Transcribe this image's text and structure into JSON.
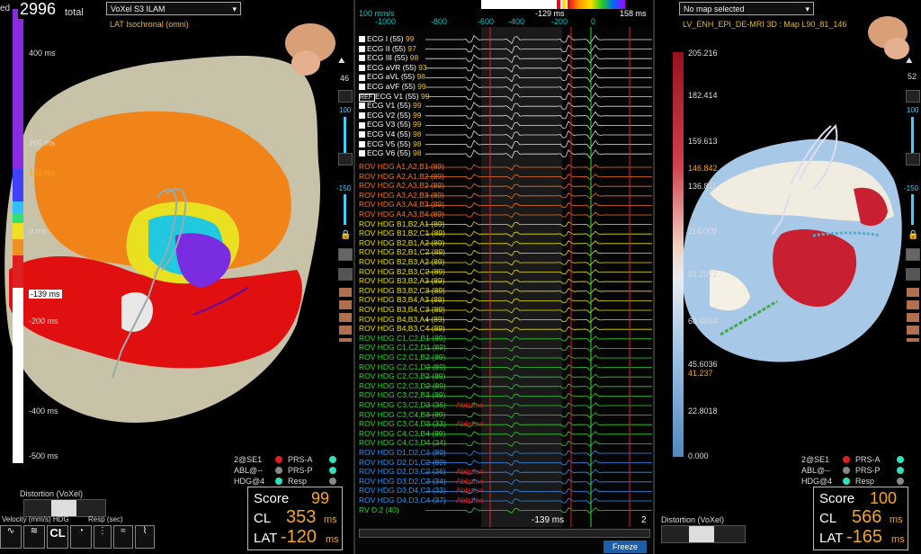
{
  "left": {
    "header_points": "2996",
    "header_total": "total",
    "header_prefix": "ed",
    "map_select": "VoXel S3 ILAM",
    "map_subtitle": "LAT Isochronal (omni)",
    "scale_labels": [
      "400 ms",
      "200 ms",
      "131 ms",
      "0 ms",
      "-139 ms",
      "-200 ms",
      "-400 ms",
      "-500 ms"
    ],
    "score_label": "Score",
    "score_value": "99",
    "cl_label": "CL",
    "cl_value": "353",
    "cl_unit": "ms",
    "lat_label": "LAT",
    "lat_value": "-120",
    "lat_unit": "ms",
    "legend": [
      {
        "a": "2@SE1",
        "b": "PRS-A"
      },
      {
        "a": "ABL@--",
        "b": "PRS-P"
      },
      {
        "a": "HDG@4",
        "b": "Resp"
      }
    ],
    "distortion_label": "Distortion (VoXel)",
    "velocity_label": "Velocity (mm/s) HDG",
    "resp_label": "Resp (sec)",
    "cl_button": "CL",
    "side_value_top": "46",
    "side_value_100": "100",
    "side_value_150": "-150"
  },
  "center": {
    "speed": "100 mm/s",
    "ticks": [
      "-1000",
      "-800",
      "-600",
      "-400",
      "-200",
      "0"
    ],
    "top_readout_left": "-129 ms",
    "top_readout_right": "158 ms",
    "bottom_readout": "-139 ms",
    "bottom_readout_right": "2",
    "freeze": "Freeze",
    "ecg_channels": [
      {
        "name": "ECG I",
        "code": "(55)",
        "val": "99"
      },
      {
        "name": "ECG II",
        "code": "(55)",
        "val": "97"
      },
      {
        "name": "ECG III",
        "code": "(55)",
        "val": "98"
      },
      {
        "name": "ECG aVR",
        "code": "(55)",
        "val": "93"
      },
      {
        "name": "ECG aVL",
        "code": "(55)",
        "val": "98"
      },
      {
        "name": "ECG aVF",
        "code": "(55)",
        "val": "99"
      },
      {
        "name": "ECG V1",
        "code": "(55)",
        "val": "99",
        "ref": "REF"
      },
      {
        "name": "ECG V1",
        "code": "(55)",
        "val": "99"
      },
      {
        "name": "ECG V2",
        "code": "(55)",
        "val": "99"
      },
      {
        "name": "ECG V3",
        "code": "(55)",
        "val": "99"
      },
      {
        "name": "ECG V4",
        "code": "(55)",
        "val": "98"
      },
      {
        "name": "ECG V5",
        "code": "(55)",
        "val": "98"
      },
      {
        "name": "ECG V6",
        "code": "(55)",
        "val": "98"
      }
    ],
    "hdg_channels": [
      {
        "label": "ROV HDG  A1,A2,B1 (89)",
        "color": "#f07020"
      },
      {
        "label": "ROV HDG  A2,A1,B2 (89)",
        "color": "#f07020"
      },
      {
        "label": "ROV HDG  A2,A3,B2 (89)",
        "color": "#f07020"
      },
      {
        "label": "ROV HDG  A3,A2,B3 (89)",
        "color": "#f07020"
      },
      {
        "label": "ROV HDG  A3,A4,B3 (89)",
        "color": "#f07020"
      },
      {
        "label": "ROV HDG  A4,A3,B4 (89)",
        "color": "#f07020"
      },
      {
        "label": "ROV HDG  B1,B2,A1 (89)",
        "color": "#e8e000"
      },
      {
        "label": "ROV HDG  B1,B2,C1 (89)",
        "color": "#e8e000"
      },
      {
        "label": "ROV HDG  B2,B1,A2 (89)",
        "color": "#e8e000"
      },
      {
        "label": "ROV HDG  B2,B1,C2 (89)",
        "color": "#e8e000"
      },
      {
        "label": "ROV HDG  B2,B3,A2 (89)",
        "color": "#e8e000"
      },
      {
        "label": "ROV HDG  B2,B3,C2 (89)",
        "color": "#e8e000"
      },
      {
        "label": "ROV HDG  B3,B2,A3 (89)",
        "color": "#e8e000"
      },
      {
        "label": "ROV HDG  B3,B2,C3 (89)",
        "color": "#e8e000"
      },
      {
        "label": "ROV HDG  B3,B4,A3 (89)",
        "color": "#e8e000"
      },
      {
        "label": "ROV HDG  B3,B4,C3 (89)",
        "color": "#e8e000"
      },
      {
        "label": "ROV HDG  B4,B3,A4 (89)",
        "color": "#e8e000"
      },
      {
        "label": "ROV HDG  B4,B3,C4 (89)",
        "color": "#e8e000"
      },
      {
        "label": "ROV HDG  C1,C2,B1 (89)",
        "color": "#30d030"
      },
      {
        "label": "ROV HDG  C1,C2,D1 (89)",
        "color": "#30d030"
      },
      {
        "label": "ROV HDG  C2,C1,B2 (89)",
        "color": "#30d030"
      },
      {
        "label": "ROV HDG  C2,C1,D2 (89)",
        "color": "#30d030"
      },
      {
        "label": "ROV HDG  C2,C3,B2 (89)",
        "color": "#30d030"
      },
      {
        "label": "ROV HDG  C2,C3,D2 (89)",
        "color": "#30d030"
      },
      {
        "label": "ROV HDG  C3,C2,B3 (89)",
        "color": "#30d030"
      },
      {
        "label": "ROV HDG  C3,C2,D3 (36)",
        "color": "#30d030",
        "ann": "Ablation"
      },
      {
        "label": "ROV HDG  C3,C4,B3 (89)",
        "color": "#30d030"
      },
      {
        "label": "ROV HDG  C3,C4,D3 (33)",
        "color": "#30d030",
        "ann": "Ablation"
      },
      {
        "label": "ROV HDG  C4,C3,B4 (89)",
        "color": "#30d030"
      },
      {
        "label": "ROV HDG  C4,C3,D4 (34)",
        "color": "#30d030"
      },
      {
        "label": "ROV HDG  D1,D2,C1 (89)",
        "color": "#3090f0"
      },
      {
        "label": "ROV HDG  D2,D1,C2 (89)",
        "color": "#3090f0"
      },
      {
        "label": "ROV HDG  D2,D3,C2 (36)",
        "color": "#3090f0",
        "ann": "Ablation"
      },
      {
        "label": "ROV HDG  D3,D2,C3 (34)",
        "color": "#3090f0",
        "ann": "Ablation"
      },
      {
        "label": "ROV HDG  D3,D4,C3 (33)",
        "color": "#3090f0",
        "ann": "Ablation"
      },
      {
        "label": "ROV HDG  D4,D3,C4 (37)",
        "color": "#3090f0",
        "ann": "Ablation"
      },
      {
        "label": "RV D:2 (40)",
        "color": "#30d030"
      }
    ]
  },
  "right": {
    "map_select": "No map selected",
    "map_subtitle": "LV_ENH_EPI_DE-MRI 3D : Map L90_81_146",
    "scale_labels": [
      "205.216",
      "182.414",
      "159.613",
      "146.842",
      "136.811",
      "114.009",
      "91.2072",
      "68.4054",
      "45.6036",
      "41.237",
      "22.8018",
      "0.000"
    ],
    "score_label": "Score",
    "score_value": "100",
    "cl_label": "CL",
    "cl_value": "566",
    "cl_unit": "ms",
    "lat_label": "LAT",
    "lat_value": "-165",
    "lat_unit": "ms",
    "legend": [
      {
        "a": "2@SE1",
        "b": "PRS-A"
      },
      {
        "a": "ABL@--",
        "b": "PRS-P"
      },
      {
        "a": "HDG@4",
        "b": "Resp"
      }
    ],
    "distortion_label": "Distortion (VoXel)",
    "side_value_top": "52",
    "side_value_100": "100",
    "side_value_150": "-150"
  }
}
